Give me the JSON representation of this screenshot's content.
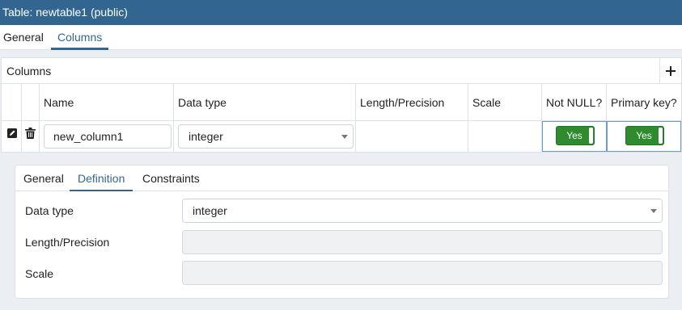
{
  "window": {
    "title": "Table: newtable1 (public)"
  },
  "main_tabs": [
    {
      "label": "General",
      "active": false
    },
    {
      "label": "Columns",
      "active": true
    }
  ],
  "columns_grid": {
    "title": "Columns",
    "add_icon": "plus-icon",
    "headers": [
      "Name",
      "Data type",
      "Length/Precision",
      "Scale",
      "Not NULL?",
      "Primary key?"
    ],
    "rows": [
      {
        "edit_icon": "edit-icon",
        "delete_icon": "trash-icon",
        "name": "new_column1",
        "data_type": "integer",
        "length_precision": "",
        "scale": "",
        "not_null": "Yes",
        "primary_key": "Yes"
      }
    ]
  },
  "detail_tabs": [
    {
      "label": "General",
      "active": false
    },
    {
      "label": "Definition",
      "active": true
    },
    {
      "label": "Constraints",
      "active": false
    }
  ],
  "definition": {
    "data_type_label": "Data type",
    "data_type_value": "integer",
    "length_label": "Length/Precision",
    "length_value": "",
    "scale_label": "Scale",
    "scale_value": ""
  },
  "colors": {
    "titlebar": "#326690",
    "accent": "#326690",
    "toggle_on": "#2e8b2e"
  }
}
